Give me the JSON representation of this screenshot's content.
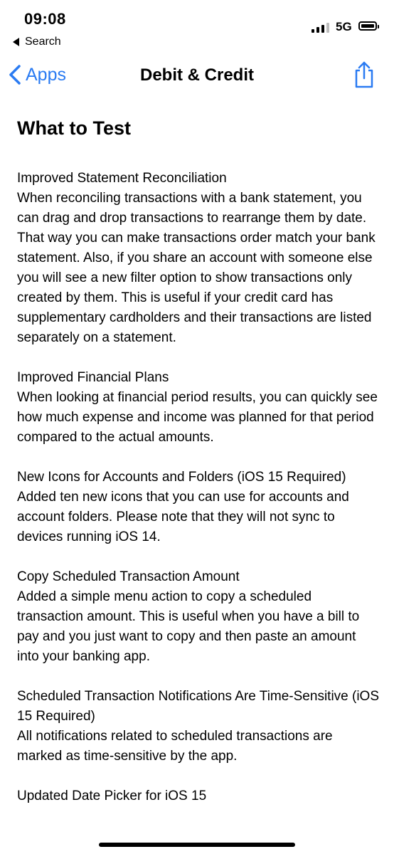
{
  "status_bar": {
    "time": "09:08",
    "back_label": "Search",
    "network": "5G"
  },
  "nav": {
    "back_label": "Apps",
    "title": "Debit & Credit",
    "accent_color": "#2a7bf2"
  },
  "content": {
    "heading": "What to Test",
    "sections": [
      {
        "title": "Improved Statement Reconciliation",
        "body": "When reconciling transactions with a bank statement, you can drag and drop transactions to rearrange them by date. That way you can make transactions order match your bank statement. Also, if you share an account with someone else you will see a new filter option to show transactions only created by them. This is useful if your credit card has supplementary cardholders and their transactions are listed separately on a statement."
      },
      {
        "title": "Improved Financial Plans",
        "body": "When looking at financial period results, you can quickly see how much expense and income was planned for that period compared to the actual amounts."
      },
      {
        "title": "New Icons for Accounts and Folders (iOS 15 Required)",
        "body": "Added ten new icons that you can use for accounts and account folders. Please note that they will not sync to devices running iOS 14."
      },
      {
        "title": "Copy Scheduled Transaction Amount",
        "body": "Added a simple menu action to copy a scheduled transaction amount. This is useful when you have a bill to pay and you just want to copy and then paste an amount into your banking app."
      },
      {
        "title": "Scheduled Transaction Notifications Are Time-Sensitive (iOS 15 Required)",
        "body": "All notifications related to scheduled transactions are marked as time-sensitive by the app."
      },
      {
        "title": "Updated Date Picker for iOS 15",
        "body": ""
      }
    ]
  }
}
